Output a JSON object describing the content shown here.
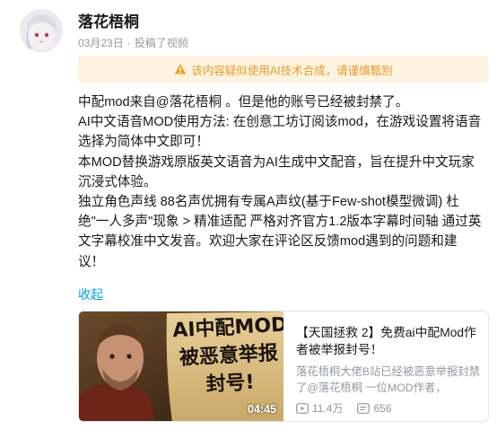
{
  "author": {
    "name": "落花梧桐",
    "date": "03月23日",
    "separator": "·",
    "action": "投稿了视频"
  },
  "notice": {
    "text": "该内容疑似使用AI技术合成，请谨慎甄别",
    "color": "#e89a2c",
    "icon": "warning-triangle-icon"
  },
  "body": {
    "lines": [
      "中配mod来自@落花梧桐 。但是他的账号已经被封禁了。",
      "AI中文语音MOD使用方法: 在创意工坊订阅该mod，在游戏设置将语音",
      "选择为简体中文即可！",
      "本MOD替换游戏原版英文语音为AI生成中文配音，旨在提升中文玩家",
      "沉浸式体验。",
      "独立角色声线 88名声优拥有专属A声纹(基于Few-shot模型微调) 杜",
      "绝\"一人多声\"现象 > 精准适配 严格对齐官方1.2版本字幕时间轴 通过英",
      "文字幕校准中文发音。欢迎大家在评论区反馈mod遇到的问题和建",
      "议！"
    ]
  },
  "collapse_label": "收起",
  "video": {
    "thumbnail_text": [
      "AI中配MOD",
      "被恶意举报",
      "封号!"
    ],
    "duration": "04:45",
    "title": "【天国拯救 2】免费ai中配Mod作者被举报封号！",
    "description": "落花梧桐大佬B站已经被恶意举报封禁了@落花梧桐 一位MOD作者，",
    "views": "11.4万",
    "comments": "656"
  },
  "colors": {
    "link": "#00a1d6",
    "muted": "#9499a0",
    "notice_bg": "#fdf3e1"
  }
}
